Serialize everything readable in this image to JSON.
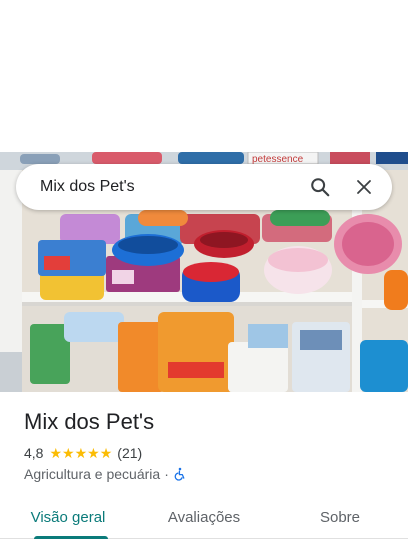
{
  "search": {
    "query": "Mix dos Pet's",
    "search_icon": "search-icon",
    "close_icon": "close-icon"
  },
  "photo": {
    "description_icon": "store-photo",
    "sign_text": "petessence"
  },
  "place": {
    "name": "Mix dos Pet's",
    "rating": "4,8",
    "review_count": "(21)",
    "stars": 5,
    "category": "Agricultura e pecuária",
    "separator": "·",
    "accessibility_icon": "wheelchair-icon"
  },
  "tabs": [
    {
      "label": "Visão geral",
      "active": true
    },
    {
      "label": "Avaliações",
      "active": false
    },
    {
      "label": "Sobre",
      "active": false
    }
  ],
  "colors": {
    "accent": "#0b7b7a",
    "star": "#fbbc04",
    "accessibility": "#1a73e8"
  }
}
